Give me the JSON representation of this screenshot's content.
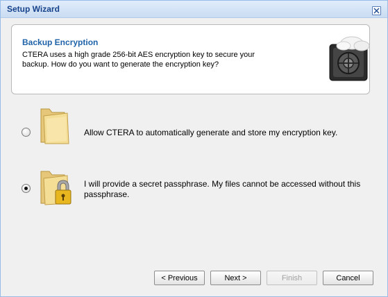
{
  "window": {
    "title": "Setup Wizard"
  },
  "header": {
    "title": "Backup Encryption",
    "description": "CTERA uses a high grade 256-bit AES encryption key to secure your backup. How do you want to generate the encryption key?"
  },
  "options": [
    {
      "label": "Allow CTERA to automatically generate and store my encryption key.",
      "selected": false,
      "icon": "folder-icon"
    },
    {
      "label": "I will provide a secret passphrase. My files cannot be accessed without this passphrase.",
      "selected": true,
      "icon": "locked-folder-icon"
    }
  ],
  "buttons": {
    "previous": "< Previous",
    "next": "Next >",
    "finish": "Finish",
    "cancel": "Cancel"
  },
  "colors": {
    "title_text": "#15428b",
    "header_title": "#1e62a8"
  }
}
